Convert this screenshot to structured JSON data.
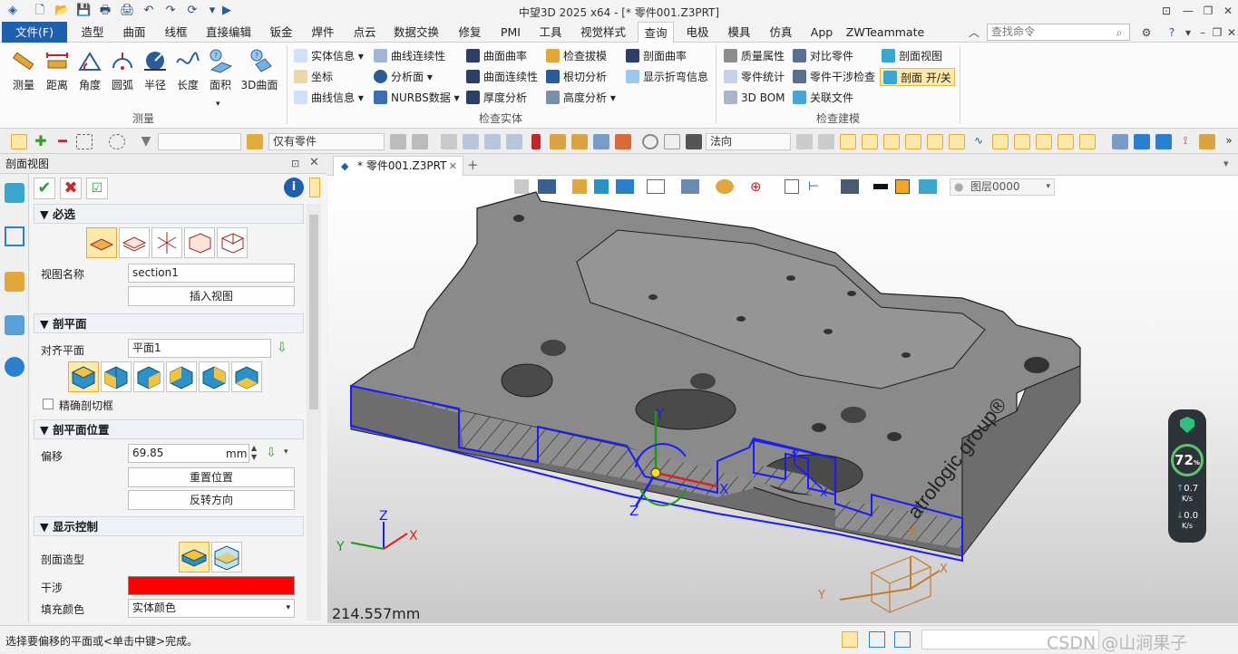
{
  "window": {
    "title": "中望3D 2025 x64 - [* 零件001.Z3PRT]"
  },
  "menu": {
    "tabs": [
      "文件(F)",
      "造型",
      "曲面",
      "线框",
      "直接编辑",
      "钣金",
      "焊件",
      "点云",
      "数据交换",
      "修复",
      "PMI",
      "工具",
      "视觉样式",
      "查询",
      "电极",
      "模具",
      "仿真",
      "App",
      "ZWTeammate"
    ],
    "active": "查询",
    "search_placeholder": "查找命令"
  },
  "ribbon": {
    "measure": {
      "label": "测量",
      "buttons": [
        "测量",
        "距离",
        "角度",
        "圆弧",
        "半径",
        "长度",
        "面积",
        "3D曲面"
      ]
    },
    "inspect": {
      "label": "检查实体",
      "col1": [
        "实体信息",
        "坐标",
        "曲线信息"
      ],
      "col2": [
        "曲线连续性",
        "分析面",
        "NURBS数据"
      ],
      "col3": [
        "曲面曲率",
        "曲面连续性",
        "厚度分析"
      ],
      "col4": [
        "检查拔模",
        "根切分析",
        "高度分析"
      ],
      "col5": [
        "剖面曲率",
        "显示折弯信息"
      ]
    },
    "model": {
      "label": "检查建模",
      "col1": [
        "质量属性",
        "零件统计",
        "3D BOM"
      ],
      "col2": [
        "对比零件",
        "零件干涉检查",
        "关联文件"
      ],
      "col3": [
        "剖面视图",
        "剖面 开/关"
      ]
    }
  },
  "toolbar": {
    "filter": "仅有零件",
    "direction": "法向"
  },
  "panel": {
    "title": "剖面视图",
    "sections": {
      "required": "必选",
      "plane": "剖平面",
      "position": "剖平面位置",
      "display": "显示控制"
    },
    "view_name_label": "视图名称",
    "view_name": "section1",
    "insert_view": "插入视图",
    "align_label": "对齐平面",
    "align_value": "平面1",
    "precise_label": "精确剖切框",
    "offset_label": "偏移",
    "offset_value": "69.85",
    "offset_unit": "mm",
    "reset_position": "重置位置",
    "reverse_direction": "反转方向",
    "section_style_label": "剖面造型",
    "interference_label": "干涉",
    "interference_color": "#ff0000",
    "fill_color_label": "填充颜色",
    "fill_color_value": "实体颜色"
  },
  "document": {
    "tab": "* 零件001.Z3PRT",
    "layer": "图层0000"
  },
  "viewport": {
    "dimension": "214.557mm",
    "brand_text": "atrologic group®",
    "axis_x": "X",
    "axis_y": "Y",
    "axis_z": "Z"
  },
  "perf": {
    "percent": "72",
    "percent_unit": "%",
    "up": "0.7",
    "down": "0.0",
    "unit": "K/s"
  },
  "status": {
    "prompt": "选择要偏移的平面或<单击中键>完成。",
    "watermark": "CSDN @山涧果子"
  },
  "colors": {
    "accent": "#1e5fae",
    "section_blue": "#1a1aff",
    "highlight": "#fde9a9"
  }
}
